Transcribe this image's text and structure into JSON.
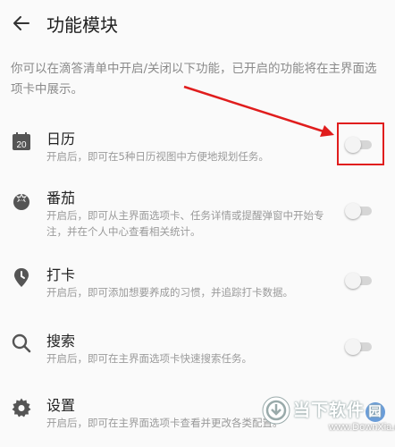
{
  "header": {
    "title": "功能模块",
    "back_icon": "arrow-left-icon"
  },
  "intro_text": "你可以在滴答清单中开启/关闭以下功能，已开启的功能将在主界面选项卡中展示。",
  "features": [
    {
      "icon": "calendar-icon",
      "calendar_day": "20",
      "title": "日历",
      "desc": "开启后，即可在5种日历视图中方便地规划任务。",
      "enabled": false
    },
    {
      "icon": "tomato-icon",
      "title": "番茄",
      "desc": "开启后，即可从主界面选项卡、任务详情或提醒弹窗中开始专注，并在个人中心查看相关统计。",
      "enabled": false
    },
    {
      "icon": "pin-icon",
      "title": "打卡",
      "desc": "开启后，即可添加想要养成的习惯，并追踪打卡数据。",
      "enabled": false
    },
    {
      "icon": "search-icon",
      "title": "搜索",
      "desc": "开启后，即可在主界面选项卡快速搜索任务。",
      "enabled": false
    },
    {
      "icon": "gear-icon",
      "title": "设置",
      "desc": "开启后，即可在主界面选项卡查看并更改各类配置。",
      "enabled": false
    }
  ],
  "annotation": {
    "color": "#e01d1d"
  },
  "watermark": {
    "main": "当下软件",
    "badge": "园",
    "sub": "www.DownXia.com"
  }
}
